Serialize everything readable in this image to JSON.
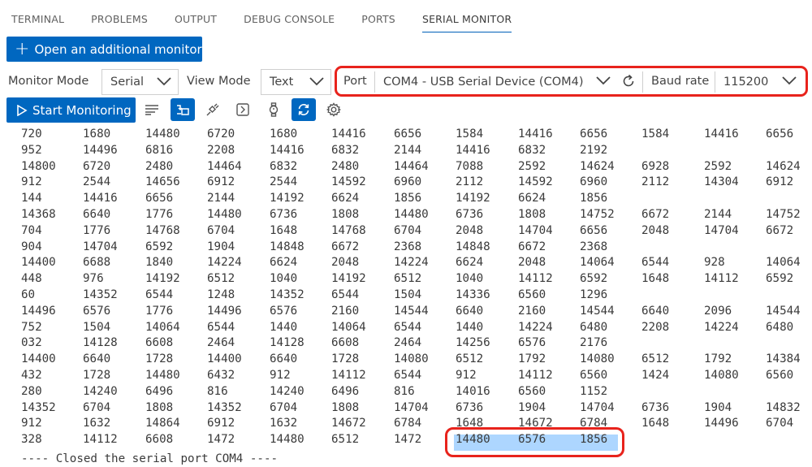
{
  "tabs": [
    "TERMINAL",
    "PROBLEMS",
    "OUTPUT",
    "DEBUG CONSOLE",
    "PORTS",
    "SERIAL MONITOR"
  ],
  "active_tab": "SERIAL MONITOR",
  "open_monitor_label": "Open an additional monitor",
  "settings": {
    "monitor_mode_label": "Monitor Mode",
    "monitor_mode_value": "Serial",
    "view_mode_label": "View Mode",
    "view_mode_value": "Text",
    "port_label": "Port",
    "port_value": "COM4 - USB Serial Device (COM4)",
    "baud_label": "Baud rate",
    "baud_value": "115200"
  },
  "toolbar": {
    "start_label": "Start Monitoring",
    "icons": [
      "list-icon",
      "toggle-terminal-icon",
      "plug-icon",
      "arrow-right-box-icon",
      "watch-icon",
      "sync-icon",
      "gear-icon"
    ]
  },
  "output_lines": [
    [
      "720",
      "1680",
      "14480",
      "6720",
      "1680",
      "14416",
      "6656",
      "1584",
      "14416",
      "6656",
      "1584",
      "14416",
      "6656"
    ],
    [
      "952",
      "14496",
      "6816",
      "2208",
      "14416",
      "6832",
      "2144",
      "14416",
      "6832",
      "2192"
    ],
    [
      "14800",
      "6720",
      "2480",
      "14464",
      "6832",
      "2480",
      "14464",
      "7088",
      "2592",
      "14624",
      "6928",
      "2592",
      "14624"
    ],
    [
      "912",
      "2544",
      "14656",
      "6912",
      "2544",
      "14592",
      "6960",
      "2112",
      "14592",
      "6960",
      "2112",
      "14304",
      "6912"
    ],
    [
      "144",
      "14416",
      "6656",
      "2144",
      "14192",
      "6624",
      "1856",
      "14192",
      "6624",
      "1856"
    ],
    [
      "14368",
      "6640",
      "1776",
      "14480",
      "6736",
      "1808",
      "14480",
      "6736",
      "1808",
      "14752",
      "6672",
      "2144",
      "14752"
    ],
    [
      "704",
      "1776",
      "14768",
      "6704",
      "1648",
      "14768",
      "6704",
      "2048",
      "14704",
      "6656",
      "2048",
      "14704",
      "6672"
    ],
    [
      "904",
      "14704",
      "6592",
      "1904",
      "14848",
      "6672",
      "2368",
      "14848",
      "6672",
      "2368"
    ],
    [
      "14400",
      "6688",
      "1840",
      "14224",
      "6624",
      "2048",
      "14224",
      "6624",
      "2048",
      "14064",
      "6544",
      "928",
      "14064"
    ],
    [
      "448",
      "976",
      "14192",
      "6512",
      "1040",
      "14192",
      "6512",
      "1040",
      "14112",
      "6592",
      "1648",
      "14112",
      "6592"
    ],
    [
      "60",
      "14352",
      "6544",
      "1248",
      "14352",
      "6544",
      "1504",
      "14336",
      "6560",
      "1296"
    ],
    [
      "14496",
      "6576",
      "1776",
      "14496",
      "6576",
      "2160",
      "14544",
      "6640",
      "2160",
      "14544",
      "6640",
      "2096",
      "14544"
    ],
    [
      "752",
      "1504",
      "14064",
      "6544",
      "1440",
      "14064",
      "6544",
      "1440",
      "14224",
      "6480",
      "2208",
      "14224",
      "6480"
    ],
    [
      "032",
      "14128",
      "6608",
      "2464",
      "14128",
      "6608",
      "2464",
      "14256",
      "6576",
      "2176"
    ],
    [
      "14400",
      "6640",
      "1728",
      "14400",
      "6640",
      "1728",
      "14080",
      "6512",
      "1792",
      "14080",
      "6512",
      "1792",
      "14384"
    ],
    [
      "432",
      "1728",
      "14480",
      "6432",
      "912",
      "14112",
      "6544",
      "912",
      "14112",
      "6560",
      "1424",
      "14080",
      "6560"
    ],
    [
      "280",
      "14240",
      "6496",
      "816",
      "14240",
      "6496",
      "816",
      "14016",
      "6560",
      "1152"
    ],
    [
      "14352",
      "6704",
      "1808",
      "14352",
      "6704",
      "1808",
      "14704",
      "6736",
      "1904",
      "14704",
      "6736",
      "1904",
      "14832"
    ],
    [
      "912",
      "1632",
      "14864",
      "6912",
      "1632",
      "14672",
      "6784",
      "1648",
      "14672",
      "6784",
      "1648",
      "14496",
      "6704"
    ],
    [
      "328",
      "14112",
      "6608",
      "1472",
      "14480",
      "6512",
      "1472",
      "14480",
      "6576",
      "1856"
    ]
  ],
  "closed_message": "---- Closed the serial port COM4 ----"
}
